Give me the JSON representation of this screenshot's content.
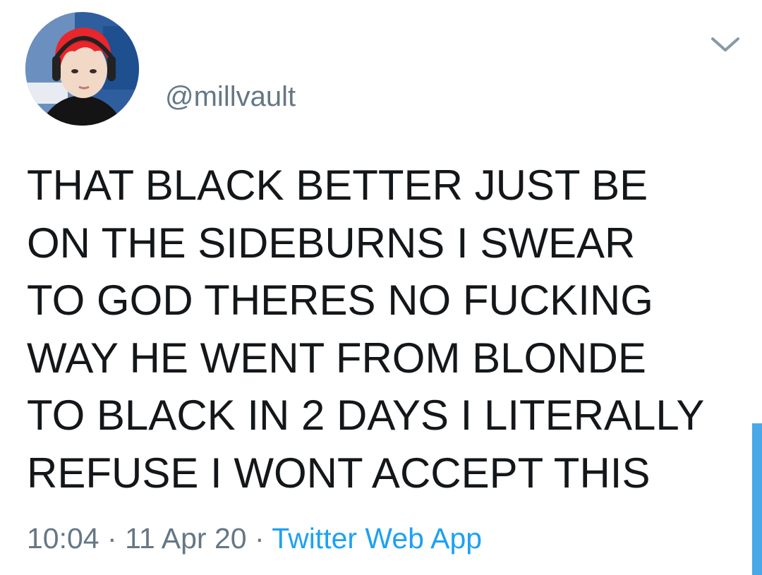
{
  "profile": {
    "handle": "@millvault",
    "avatar_icon": "profile-avatar-image"
  },
  "menu": {
    "icon": "chevron-down-icon"
  },
  "tweet": {
    "lines": [
      "THAT BLACK BETTER JUST BE",
      "ON THE SIDEBURNS I SWEAR",
      "TO GOD THERES NO FUCKING",
      "WAY HE WENT FROM BLONDE",
      "TO BLACK IN 2 DAYS I LITERALLY",
      "REFUSE I WONT ACCEPT THIS"
    ]
  },
  "meta": {
    "time": "10:04",
    "separator": "·",
    "date": "11 Apr 20",
    "source": "Twitter Web App"
  },
  "colors": {
    "text": "#14171a",
    "secondary": "#657786",
    "link": "#1da1f2",
    "scrollbar": "#4aa8e8"
  }
}
